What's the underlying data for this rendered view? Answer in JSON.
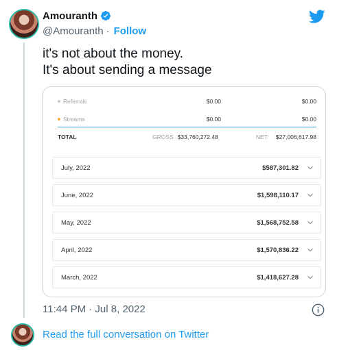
{
  "tweet": {
    "display_name": "Amouranth",
    "handle": "@Amouranth",
    "separator": "·",
    "follow_label": "Follow",
    "text": "it's not about the money.\nIt's about sending a message",
    "timestamp": "11:44 PM · Jul 8, 2022",
    "read_more": "Read the full conversation on Twitter"
  },
  "earnings": {
    "rows": [
      {
        "label": "Referrals",
        "gross": "$0.00",
        "net": "$0.00",
        "dot_color": "#c5c9ce"
      },
      {
        "label": "Streams",
        "gross": "$0.00",
        "net": "$0.00",
        "dot_color": "#f5b041"
      }
    ],
    "total": {
      "label": "TOTAL",
      "gross_label": "GROSS",
      "gross": "$33,760,272.48",
      "net_label": "NET",
      "net": "$27,006,617.98"
    },
    "months": [
      {
        "month": "July, 2022",
        "amount": "$587,301.82"
      },
      {
        "month": "June, 2022",
        "amount": "$1,598,110.17"
      },
      {
        "month": "May, 2022",
        "amount": "$1,568,752.58"
      },
      {
        "month": "April, 2022",
        "amount": "$1,570,836.22"
      },
      {
        "month": "March, 2022",
        "amount": "$1,418,627.28"
      }
    ]
  },
  "colors": {
    "accent": "#1d9bf0",
    "verified": "#1d9bf0",
    "rule": "#39a0e6"
  },
  "icons": {
    "brand": "twitter-bird-icon",
    "verified": "verified-badge-icon",
    "expand": "chevron-down-icon",
    "info": "info-icon"
  }
}
